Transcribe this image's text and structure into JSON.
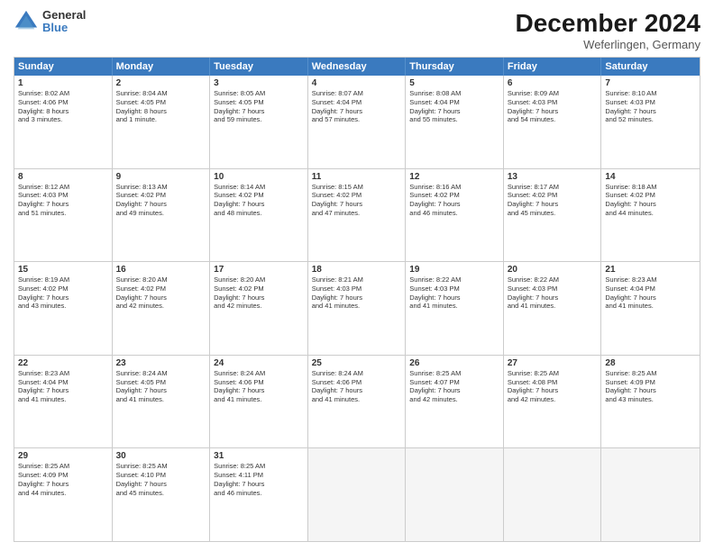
{
  "header": {
    "logo_line1": "General",
    "logo_line2": "Blue",
    "title": "December 2024",
    "subtitle": "Weferlingen, Germany"
  },
  "weekdays": [
    "Sunday",
    "Monday",
    "Tuesday",
    "Wednesday",
    "Thursday",
    "Friday",
    "Saturday"
  ],
  "rows": [
    [
      {
        "day": "1",
        "lines": [
          "Sunrise: 8:02 AM",
          "Sunset: 4:06 PM",
          "Daylight: 8 hours",
          "and 3 minutes."
        ]
      },
      {
        "day": "2",
        "lines": [
          "Sunrise: 8:04 AM",
          "Sunset: 4:05 PM",
          "Daylight: 8 hours",
          "and 1 minute."
        ]
      },
      {
        "day": "3",
        "lines": [
          "Sunrise: 8:05 AM",
          "Sunset: 4:05 PM",
          "Daylight: 7 hours",
          "and 59 minutes."
        ]
      },
      {
        "day": "4",
        "lines": [
          "Sunrise: 8:07 AM",
          "Sunset: 4:04 PM",
          "Daylight: 7 hours",
          "and 57 minutes."
        ]
      },
      {
        "day": "5",
        "lines": [
          "Sunrise: 8:08 AM",
          "Sunset: 4:04 PM",
          "Daylight: 7 hours",
          "and 55 minutes."
        ]
      },
      {
        "day": "6",
        "lines": [
          "Sunrise: 8:09 AM",
          "Sunset: 4:03 PM",
          "Daylight: 7 hours",
          "and 54 minutes."
        ]
      },
      {
        "day": "7",
        "lines": [
          "Sunrise: 8:10 AM",
          "Sunset: 4:03 PM",
          "Daylight: 7 hours",
          "and 52 minutes."
        ]
      }
    ],
    [
      {
        "day": "8",
        "lines": [
          "Sunrise: 8:12 AM",
          "Sunset: 4:03 PM",
          "Daylight: 7 hours",
          "and 51 minutes."
        ]
      },
      {
        "day": "9",
        "lines": [
          "Sunrise: 8:13 AM",
          "Sunset: 4:02 PM",
          "Daylight: 7 hours",
          "and 49 minutes."
        ]
      },
      {
        "day": "10",
        "lines": [
          "Sunrise: 8:14 AM",
          "Sunset: 4:02 PM",
          "Daylight: 7 hours",
          "and 48 minutes."
        ]
      },
      {
        "day": "11",
        "lines": [
          "Sunrise: 8:15 AM",
          "Sunset: 4:02 PM",
          "Daylight: 7 hours",
          "and 47 minutes."
        ]
      },
      {
        "day": "12",
        "lines": [
          "Sunrise: 8:16 AM",
          "Sunset: 4:02 PM",
          "Daylight: 7 hours",
          "and 46 minutes."
        ]
      },
      {
        "day": "13",
        "lines": [
          "Sunrise: 8:17 AM",
          "Sunset: 4:02 PM",
          "Daylight: 7 hours",
          "and 45 minutes."
        ]
      },
      {
        "day": "14",
        "lines": [
          "Sunrise: 8:18 AM",
          "Sunset: 4:02 PM",
          "Daylight: 7 hours",
          "and 44 minutes."
        ]
      }
    ],
    [
      {
        "day": "15",
        "lines": [
          "Sunrise: 8:19 AM",
          "Sunset: 4:02 PM",
          "Daylight: 7 hours",
          "and 43 minutes."
        ]
      },
      {
        "day": "16",
        "lines": [
          "Sunrise: 8:20 AM",
          "Sunset: 4:02 PM",
          "Daylight: 7 hours",
          "and 42 minutes."
        ]
      },
      {
        "day": "17",
        "lines": [
          "Sunrise: 8:20 AM",
          "Sunset: 4:02 PM",
          "Daylight: 7 hours",
          "and 42 minutes."
        ]
      },
      {
        "day": "18",
        "lines": [
          "Sunrise: 8:21 AM",
          "Sunset: 4:03 PM",
          "Daylight: 7 hours",
          "and 41 minutes."
        ]
      },
      {
        "day": "19",
        "lines": [
          "Sunrise: 8:22 AM",
          "Sunset: 4:03 PM",
          "Daylight: 7 hours",
          "and 41 minutes."
        ]
      },
      {
        "day": "20",
        "lines": [
          "Sunrise: 8:22 AM",
          "Sunset: 4:03 PM",
          "Daylight: 7 hours",
          "and 41 minutes."
        ]
      },
      {
        "day": "21",
        "lines": [
          "Sunrise: 8:23 AM",
          "Sunset: 4:04 PM",
          "Daylight: 7 hours",
          "and 41 minutes."
        ]
      }
    ],
    [
      {
        "day": "22",
        "lines": [
          "Sunrise: 8:23 AM",
          "Sunset: 4:04 PM",
          "Daylight: 7 hours",
          "and 41 minutes."
        ]
      },
      {
        "day": "23",
        "lines": [
          "Sunrise: 8:24 AM",
          "Sunset: 4:05 PM",
          "Daylight: 7 hours",
          "and 41 minutes."
        ]
      },
      {
        "day": "24",
        "lines": [
          "Sunrise: 8:24 AM",
          "Sunset: 4:06 PM",
          "Daylight: 7 hours",
          "and 41 minutes."
        ]
      },
      {
        "day": "25",
        "lines": [
          "Sunrise: 8:24 AM",
          "Sunset: 4:06 PM",
          "Daylight: 7 hours",
          "and 41 minutes."
        ]
      },
      {
        "day": "26",
        "lines": [
          "Sunrise: 8:25 AM",
          "Sunset: 4:07 PM",
          "Daylight: 7 hours",
          "and 42 minutes."
        ]
      },
      {
        "day": "27",
        "lines": [
          "Sunrise: 8:25 AM",
          "Sunset: 4:08 PM",
          "Daylight: 7 hours",
          "and 42 minutes."
        ]
      },
      {
        "day": "28",
        "lines": [
          "Sunrise: 8:25 AM",
          "Sunset: 4:09 PM",
          "Daylight: 7 hours",
          "and 43 minutes."
        ]
      }
    ],
    [
      {
        "day": "29",
        "lines": [
          "Sunrise: 8:25 AM",
          "Sunset: 4:09 PM",
          "Daylight: 7 hours",
          "and 44 minutes."
        ]
      },
      {
        "day": "30",
        "lines": [
          "Sunrise: 8:25 AM",
          "Sunset: 4:10 PM",
          "Daylight: 7 hours",
          "and 45 minutes."
        ]
      },
      {
        "day": "31",
        "lines": [
          "Sunrise: 8:25 AM",
          "Sunset: 4:11 PM",
          "Daylight: 7 hours",
          "and 46 minutes."
        ]
      },
      null,
      null,
      null,
      null
    ]
  ]
}
